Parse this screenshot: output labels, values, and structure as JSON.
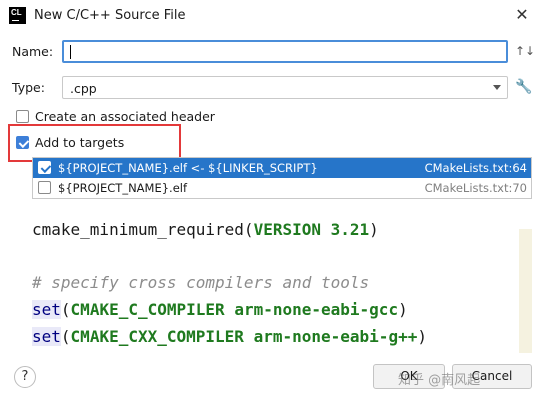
{
  "window": {
    "app_icon_text": "CL",
    "title": "New C/C++ Source File",
    "close_glyph": "✕"
  },
  "form": {
    "name_label": "Name:",
    "name_value": "",
    "sort_icon": "sort-icon",
    "sort_glyph": "↑↓",
    "type_label": "Type:",
    "type_value": ".cpp",
    "settings_icon": "wrench-icon",
    "wrench_glyph": "🔧"
  },
  "options": {
    "create_header_label": "Create an associated header",
    "create_header_checked": false,
    "add_to_targets_label": "Add to targets",
    "add_to_targets_checked": true
  },
  "targets": [
    {
      "name": "${PROJECT_NAME}.elf <- ${LINKER_SCRIPT}",
      "file": "CMakeLists.txt:64",
      "checked": true,
      "selected": true
    },
    {
      "name": "${PROJECT_NAME}.elf",
      "file": "CMakeLists.txt:70",
      "checked": false,
      "selected": false
    }
  ],
  "code_preview": {
    "lines": [
      "cmake_minimum_required(VERSION 3.21)",
      "",
      "# specify cross compilers and tools",
      "set(CMAKE_C_COMPILER arm-none-eabi-gcc)",
      "set(CMAKE_CXX_COMPILER arm-none-eabi-g++)"
    ]
  },
  "footer": {
    "help_glyph": "?",
    "ok_label": "OK",
    "cancel_label": "Cancel",
    "watermark": "知乎 @南风起"
  },
  "colors": {
    "accent": "#2675c9",
    "highlight_box": "#e3393a",
    "input_focus": "#4a8dd9"
  }
}
